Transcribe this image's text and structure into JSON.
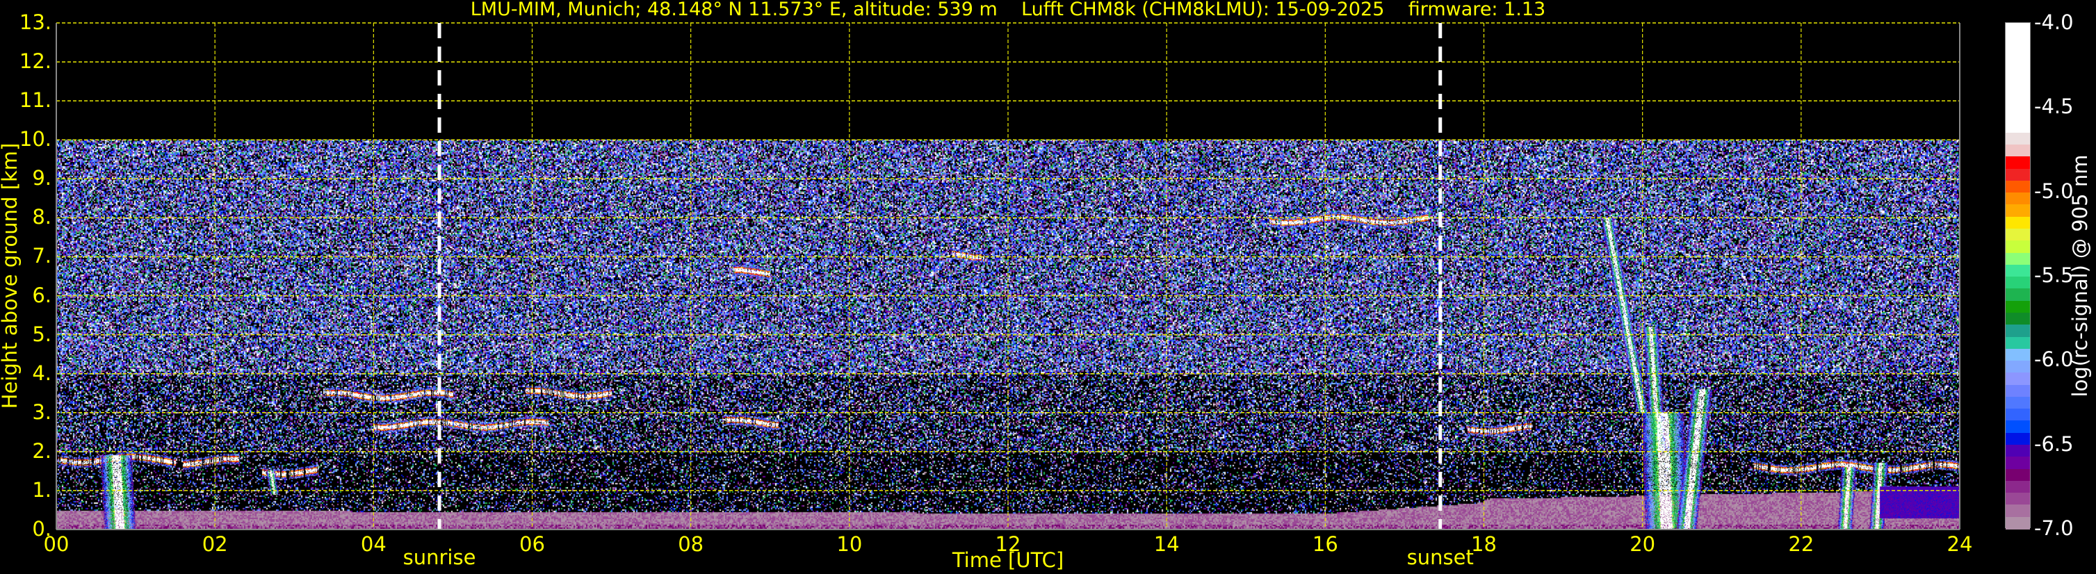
{
  "title": "LMU-MIM, Munich; 48.148° N 11.573° E, altitude: 539 m    Lufft CHM8k (CHM8kLMU): 15-09-2025    firmware: 1.13",
  "chart_data": {
    "type": "heatmap",
    "xlabel": "Time [UTC]",
    "ylabel": "Height above ground [km]",
    "xlim": [
      0,
      24
    ],
    "ylim": [
      0,
      13
    ],
    "x_ticks": [
      "00",
      "02",
      "04",
      "06",
      "08",
      "10",
      "12",
      "14",
      "16",
      "18",
      "20",
      "22",
      "24"
    ],
    "y_ticks": [
      "0.",
      "1.",
      "2.",
      "3.",
      "4.",
      "5.",
      "6.",
      "7.",
      "8.",
      "9.",
      "10.",
      "11.",
      "12.",
      "13."
    ],
    "grid": true,
    "data_max_height_km": 10,
    "events": [
      {
        "label": "sunrise",
        "time_h": 4.83
      },
      {
        "label": "sunset",
        "time_h": 17.45
      }
    ],
    "colorbar": {
      "label": "log(rc-signal) @ 905 nm",
      "range": [
        -7.0,
        -4.0
      ],
      "ticks": [
        "-4.0",
        "-4.5",
        "-5.0",
        "-5.5",
        "-6.0",
        "-6.5",
        "-7.0"
      ],
      "white_above": -4.65,
      "colors": [
        "#ede0e0",
        "#f0c4c4",
        "#ff0000",
        "#f02424",
        "#ff5a00",
        "#ff8c00",
        "#ffaa00",
        "#ffe600",
        "#e6f53c",
        "#c8ff3c",
        "#8cff78",
        "#3ce696",
        "#28d278",
        "#1eb450",
        "#14a00a",
        "#0f8c28",
        "#1ea08c",
        "#28c8a0",
        "#82bfff",
        "#82a8ff",
        "#8c96ff",
        "#6e82ff",
        "#5078ff",
        "#3264ff",
        "#0050ff",
        "#0014e6",
        "#5000b4",
        "#6e00a0",
        "#780070",
        "#8c288c",
        "#9a4896",
        "#a870a0",
        "#b090a8"
      ]
    },
    "cloud_layers": [
      {
        "start_h": 0.0,
        "end_h": 1.5,
        "height_km": 1.8
      },
      {
        "start_h": 1.6,
        "end_h": 2.3,
        "height_km": 1.75
      },
      {
        "start_h": 2.6,
        "end_h": 3.3,
        "height_km": 1.5
      },
      {
        "start_h": 3.4,
        "end_h": 5.0,
        "height_km": 3.45
      },
      {
        "start_h": 5.9,
        "end_h": 7.0,
        "height_km": 3.5
      },
      {
        "start_h": 4.0,
        "end_h": 6.2,
        "height_km": 2.7
      },
      {
        "start_h": 8.4,
        "end_h": 9.1,
        "height_km": 2.75
      },
      {
        "start_h": 8.5,
        "end_h": 9.0,
        "height_km": 6.6
      },
      {
        "start_h": 11.3,
        "end_h": 11.7,
        "height_km": 7.05
      },
      {
        "start_h": 15.3,
        "end_h": 17.3,
        "height_km": 7.95
      },
      {
        "start_h": 17.8,
        "end_h": 18.6,
        "height_km": 2.6
      },
      {
        "start_h": 21.4,
        "end_h": 24.0,
        "height_km": 1.6
      }
    ],
    "boundary_layer_top_km": {
      "00": 0.5,
      "12": 0.45,
      "18": 0.8,
      "24": 1.0
    }
  }
}
